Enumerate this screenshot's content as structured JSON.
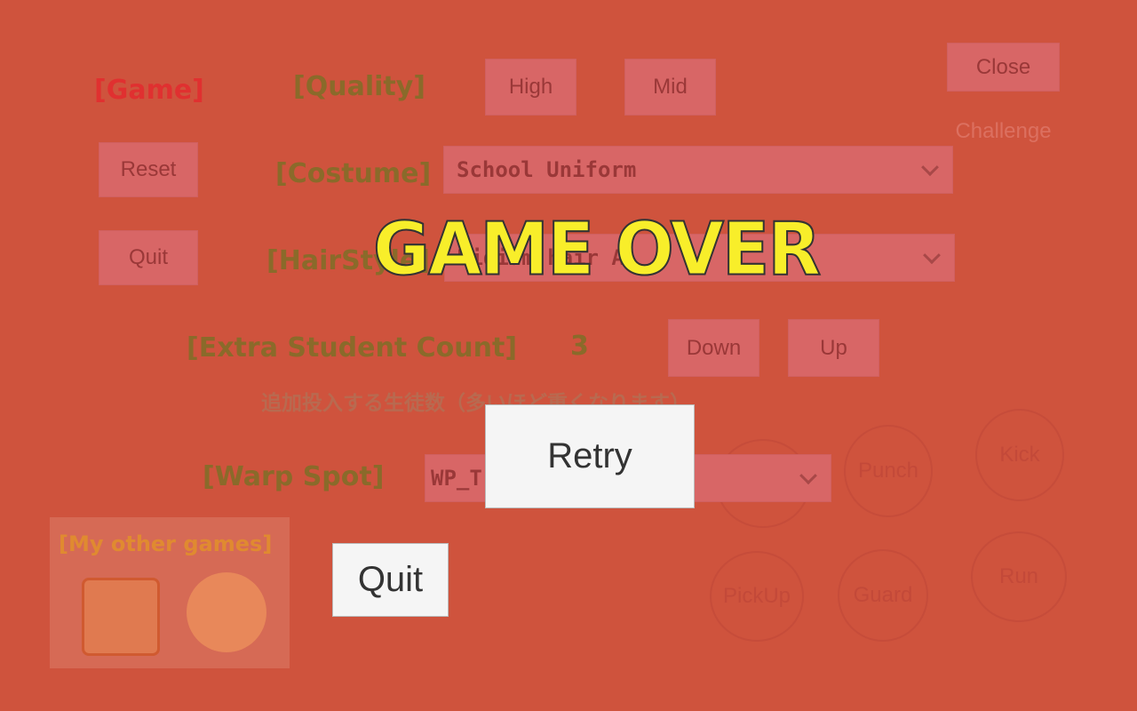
{
  "menu": {
    "game_label": "[Game]",
    "quality_label": "[Quality]",
    "quality_high": "High",
    "quality_mid": "Mid",
    "close": "Close",
    "challenge": "Challenge",
    "reset": "Reset",
    "quit": "Quit",
    "costume_label": "[Costume]",
    "costume_value": "School Uniform",
    "hairstyle_label": "[HairStyle]",
    "hairstyle_value": "Midium hair A",
    "extra_label": "[Extra Student Count]",
    "extra_value": "3",
    "down": "Down",
    "up": "Up",
    "extra_note": "追加投入する生徒数（多いほど重くなります）",
    "warp_label": "[Warp Spot]",
    "warp_value": "WP_T",
    "other_games_label": "[My other games]"
  },
  "controls": [
    "Punch",
    "Kick",
    "PickUp",
    "Guard",
    "Run"
  ],
  "game_over": {
    "title": "GAME OVER",
    "retry": "Retry",
    "quit": "Quit"
  },
  "colors": {
    "overlay": "#cf533d",
    "title": "#f8ee2a",
    "game_label": "#e03030"
  }
}
